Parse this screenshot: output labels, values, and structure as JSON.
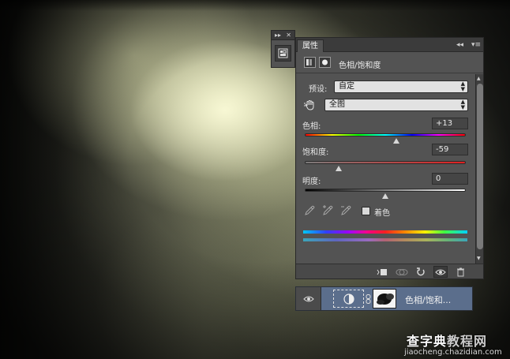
{
  "panel": {
    "tab_label": "属性",
    "title": "色相/饱和度"
  },
  "preset": {
    "label": "预设:",
    "value": "自定"
  },
  "channel": {
    "value": "全图"
  },
  "hue": {
    "label": "色相:",
    "value": "+13",
    "slider_fraction": 0.57
  },
  "saturation": {
    "label": "饱和度:",
    "value": "-59",
    "slider_fraction": 0.21
  },
  "lightness": {
    "label": "明度:",
    "value": "0",
    "slider_fraction": 0.5
  },
  "colorize": {
    "label": "着色",
    "checked": false
  },
  "layer": {
    "name": "色相/饱和..."
  },
  "watermark": {
    "main_black": "查字典",
    "main_gray": "教程网",
    "sub": "jiaocheng.chazidian.com"
  },
  "icons": {
    "mini_tool": "properties-icon",
    "footer": [
      "clip-to-layer-icon",
      "view-previous-icon",
      "reset-icon",
      "visibility-icon",
      "delete-icon"
    ]
  },
  "colors": {
    "panel_bg": "#535353",
    "layer_selected": "#5b6e8c"
  }
}
